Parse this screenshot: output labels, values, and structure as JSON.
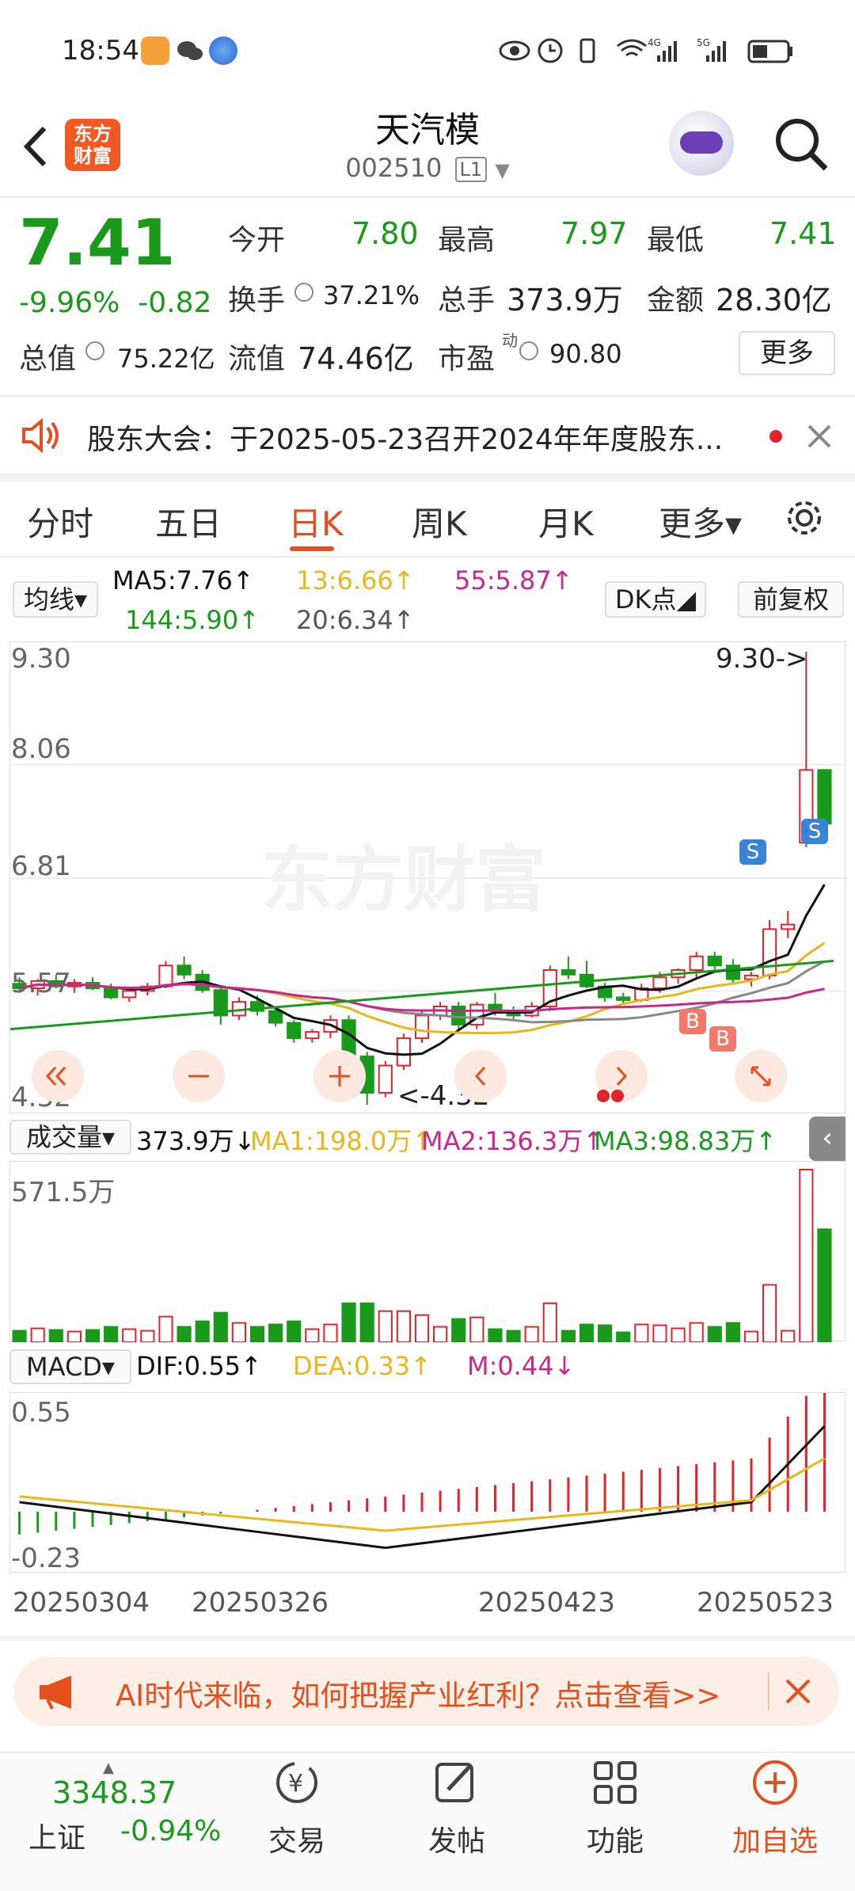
{
  "status_bar": {
    "time": "18:54",
    "net1": "4G",
    "net2": "5G"
  },
  "header": {
    "title": "天汽模",
    "code": "002510",
    "level": "L1",
    "logo": "东方\n财富"
  },
  "quote": {
    "price": "7.41",
    "change_pct": "-9.96%",
    "change": "-0.82",
    "open_label": "今开",
    "open": "7.80",
    "high_label": "最高",
    "high": "7.97",
    "low_label": "最低",
    "low": "7.41",
    "turnover_label": "换手",
    "turnover": "37.21%",
    "volume_label": "总手",
    "volume": "373.9万",
    "amount_label": "金额",
    "amount": "28.30亿",
    "mktcap_label": "总值",
    "mktcap": "75.22亿",
    "float_label": "流值",
    "float": "74.46亿",
    "pe_label": "市盈",
    "pe_sup": "动",
    "pe": "90.80",
    "more_label": "更多"
  },
  "notice": {
    "text": "股东大会：于2025-05-23召开2024年年度股东..."
  },
  "tabs": [
    {
      "label": "分时"
    },
    {
      "label": "五日"
    },
    {
      "label": "日K"
    },
    {
      "label": "周K"
    },
    {
      "label": "月K"
    },
    {
      "label": "更多▾"
    }
  ],
  "ma_bar": {
    "selector": "均线▾",
    "ma5": "MA5:7.76↑",
    "ma13": "13:6.66↑",
    "ma55": "55:5.87↑",
    "ma144": "144:5.90↑",
    "ma20": "20:6.34↑",
    "dk": "DK点◢",
    "fq": "前复权"
  },
  "price_axis": {
    "top": "9.30",
    "l2": "8.06",
    "l3": "6.81",
    "l4": "5.57",
    "bottom": "4.32"
  },
  "price_marks": {
    "high": "9.30->",
    "low": "<-4.32",
    "sell": "S",
    "buy": "B",
    "watermark": "东方财富"
  },
  "vol_bar": {
    "selector": "成交量▾",
    "vol": "373.9万↓",
    "ma1": "MA1:198.0万↑",
    "ma2": "MA2:136.3万↑",
    "ma3": "MA3:98.83万↑",
    "axis_top": "571.5万"
  },
  "macd_bar": {
    "selector": "MACD▾",
    "dif": "DIF:0.55↑",
    "dea": "DEA:0.33↑",
    "m": "M:0.44↓",
    "axis_top": "0.55",
    "axis_bottom": "-0.23"
  },
  "dates": [
    "20250304",
    "20250326",
    "20250423",
    "20250523"
  ],
  "colors": {
    "up": "#e0242b",
    "down": "#1a9a1a",
    "accent": "#e3501d",
    "ma5": "#111111",
    "ma13": "#e8b81a",
    "ma20": "#888888",
    "ma55": "#c8288c",
    "ma144": "#1a9a1a"
  },
  "ad": {
    "text": "AI时代来临，如何把握产业红利？点击查看>>"
  },
  "bottom_nav": {
    "index_value": "3348.37",
    "index_name": "上证",
    "index_change": "-0.94%",
    "trade": "交易",
    "post": "发帖",
    "func": "功能",
    "add": "加自选"
  },
  "chart_data": {
    "type": "candlestick",
    "x_labels": [
      "20250304",
      "20250326",
      "20250423",
      "20250523"
    ],
    "ylim": [
      4.32,
      9.3
    ],
    "ohlc": [
      [
        5.65,
        5.72,
        5.55,
        5.6
      ],
      [
        5.6,
        5.7,
        5.52,
        5.68
      ],
      [
        5.68,
        5.75,
        5.6,
        5.62
      ],
      [
        5.62,
        5.7,
        5.55,
        5.66
      ],
      [
        5.66,
        5.72,
        5.58,
        5.6
      ],
      [
        5.6,
        5.65,
        5.48,
        5.5
      ],
      [
        5.5,
        5.6,
        5.45,
        5.57
      ],
      [
        5.57,
        5.66,
        5.52,
        5.62
      ],
      [
        5.62,
        5.9,
        5.6,
        5.85
      ],
      [
        5.85,
        5.95,
        5.7,
        5.75
      ],
      [
        5.75,
        5.8,
        5.55,
        5.58
      ],
      [
        5.58,
        5.62,
        5.2,
        5.3
      ],
      [
        5.3,
        5.5,
        5.25,
        5.45
      ],
      [
        5.45,
        5.52,
        5.3,
        5.35
      ],
      [
        5.35,
        5.4,
        5.18,
        5.22
      ],
      [
        5.22,
        5.25,
        5.0,
        5.05
      ],
      [
        5.05,
        5.15,
        5.0,
        5.12
      ],
      [
        5.12,
        5.3,
        5.05,
        5.25
      ],
      [
        5.25,
        5.3,
        4.8,
        4.85
      ],
      [
        4.85,
        4.9,
        4.32,
        4.45
      ],
      [
        4.45,
        4.8,
        4.4,
        4.75
      ],
      [
        4.75,
        5.1,
        4.7,
        5.05
      ],
      [
        5.05,
        5.35,
        5.0,
        5.3
      ],
      [
        5.3,
        5.45,
        5.25,
        5.4
      ],
      [
        5.4,
        5.45,
        5.15,
        5.2
      ],
      [
        5.2,
        5.45,
        5.15,
        5.42
      ],
      [
        5.42,
        5.55,
        5.3,
        5.35
      ],
      [
        5.35,
        5.4,
        5.25,
        5.3
      ],
      [
        5.3,
        5.45,
        5.28,
        5.4
      ],
      [
        5.4,
        5.85,
        5.35,
        5.8
      ],
      [
        5.8,
        5.95,
        5.7,
        5.75
      ],
      [
        5.75,
        5.9,
        5.6,
        5.62
      ],
      [
        5.62,
        5.66,
        5.45,
        5.5
      ],
      [
        5.5,
        5.55,
        5.42,
        5.47
      ],
      [
        5.47,
        5.65,
        5.45,
        5.6
      ],
      [
        5.6,
        5.78,
        5.55,
        5.72
      ],
      [
        5.72,
        5.82,
        5.65,
        5.8
      ],
      [
        5.8,
        6.0,
        5.72,
        5.95
      ],
      [
        5.95,
        6.0,
        5.8,
        5.85
      ],
      [
        5.85,
        5.92,
        5.65,
        5.7
      ],
      [
        5.7,
        5.78,
        5.62,
        5.74
      ],
      [
        5.74,
        6.35,
        5.7,
        6.25
      ],
      [
        6.25,
        6.45,
        6.15,
        6.3
      ],
      [
        7.2,
        9.3,
        7.15,
        8.0
      ],
      [
        8.0,
        7.97,
        7.41,
        7.41
      ]
    ]
  }
}
